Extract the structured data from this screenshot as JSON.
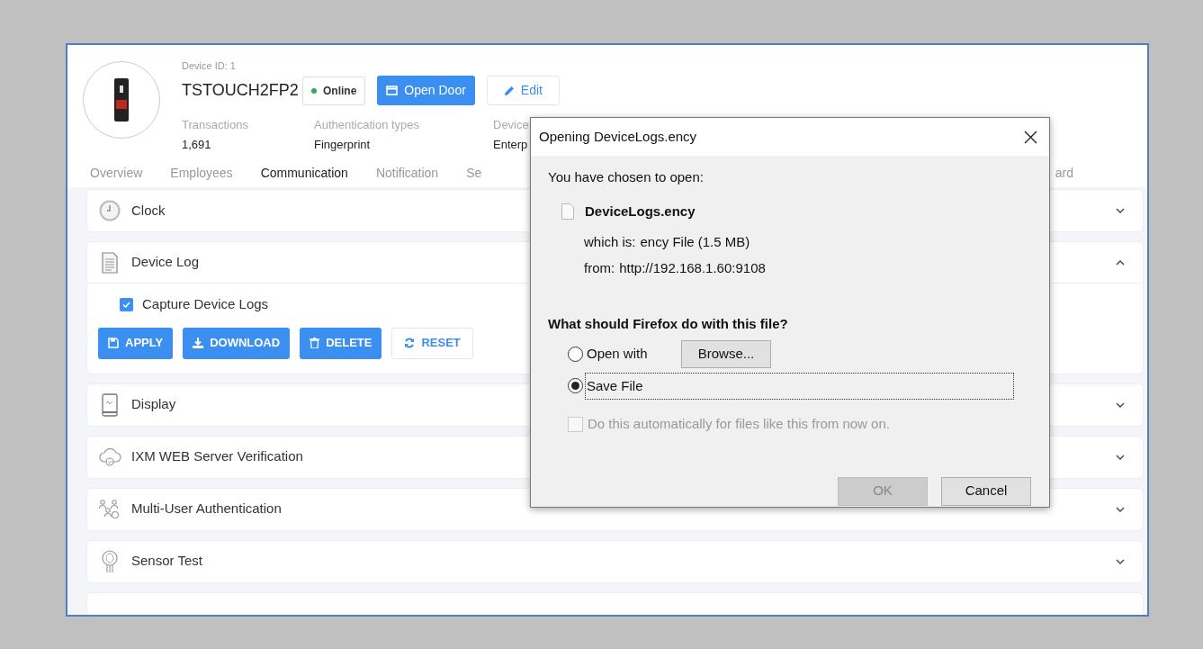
{
  "device": {
    "id_label": "Device ID: 1",
    "name": "TSTOUCH2FP2",
    "status": "Online",
    "actions": [
      {
        "label": "Open Door",
        "kind": "primary"
      },
      {
        "label": "Edit",
        "kind": "outline"
      }
    ],
    "stats": [
      {
        "label": "Transactions",
        "value": "1,691"
      },
      {
        "label": "Authentication types",
        "value": "Fingerprint"
      },
      {
        "label": "Device",
        "value": "Enterp"
      }
    ]
  },
  "tabs": [
    {
      "label": "Overview",
      "selected": false
    },
    {
      "label": "Employees",
      "selected": false
    },
    {
      "label": "Communication",
      "selected": true
    },
    {
      "label": "Notification",
      "selected": false
    },
    {
      "label": "Se",
      "selected": false
    },
    {
      "label": "ard",
      "selected": false
    }
  ],
  "sections": [
    {
      "title": "Clock",
      "expanded": false
    },
    {
      "title": "Device Log",
      "expanded": true,
      "checkbox": {
        "label": "Capture Device Logs",
        "checked": true
      },
      "buttons": [
        {
          "label": "APPLY",
          "kind": "primary"
        },
        {
          "label": "DOWNLOAD",
          "kind": "primary"
        },
        {
          "label": "DELETE",
          "kind": "primary"
        },
        {
          "label": "RESET",
          "kind": "outline"
        }
      ]
    },
    {
      "title": "Display",
      "expanded": false
    },
    {
      "title": "IXM WEB Server Verification",
      "expanded": false
    },
    {
      "title": "Multi-User Authentication",
      "expanded": false
    },
    {
      "title": "Sensor Test",
      "expanded": false
    }
  ],
  "dialog": {
    "title": "Opening DeviceLogs.ency",
    "intro": "You have chosen to open:",
    "file_name": "DeviceLogs.ency",
    "details": [
      {
        "label": "which is:",
        "value": "ency File (1.5 MB)"
      },
      {
        "label": "from:",
        "value": "http://192.168.1.60:9108"
      }
    ],
    "question": "What should Firefox do with this file?",
    "options": [
      {
        "label": "Open with",
        "selected": false,
        "button": "Browse..."
      },
      {
        "label": "Save File",
        "selected": true
      }
    ],
    "remember": {
      "label": "Do this automatically for files like this from now on.",
      "checked": false,
      "disabled": true
    },
    "buttons": [
      {
        "label": "OK",
        "disabled": true
      },
      {
        "label": "Cancel",
        "disabled": false
      }
    ]
  }
}
